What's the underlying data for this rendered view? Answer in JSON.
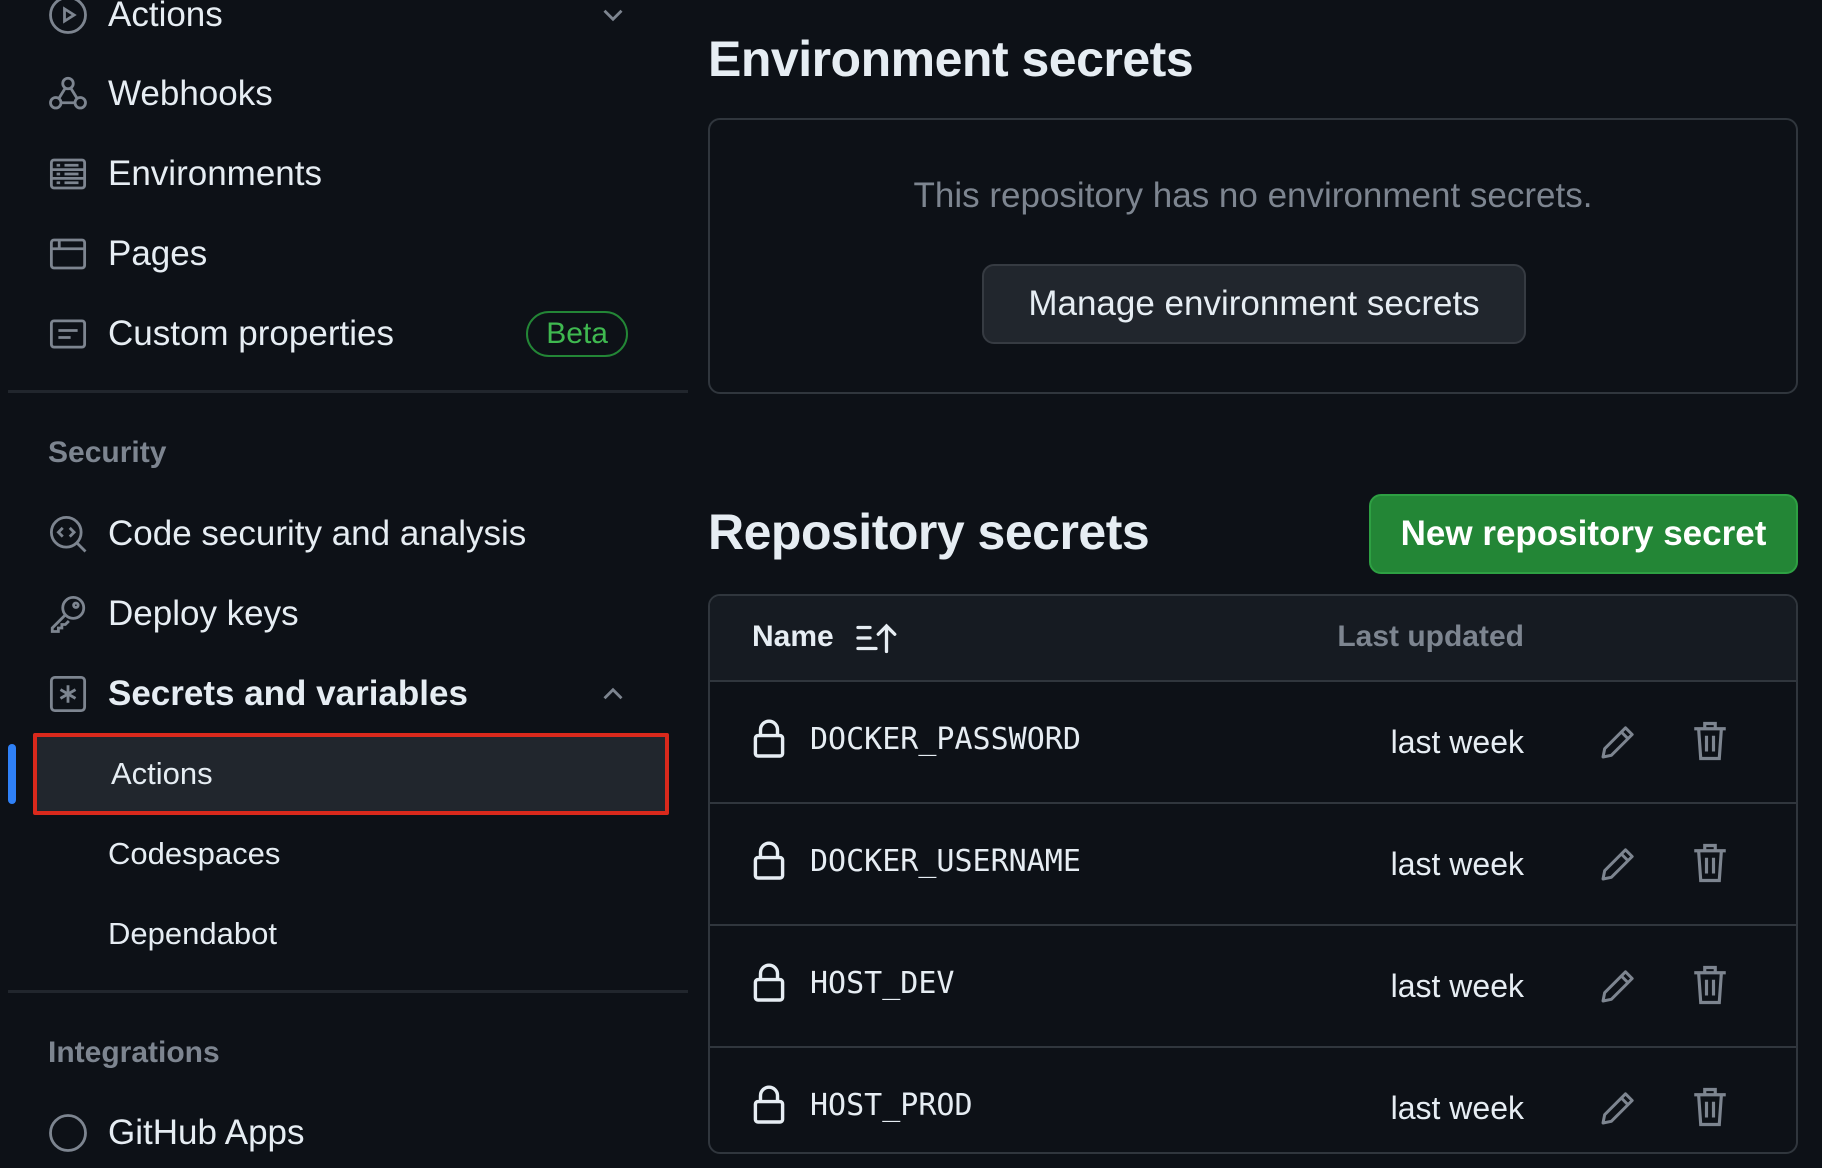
{
  "sidebar": {
    "items": [
      {
        "label": "Actions",
        "icon": "play-circle-icon"
      },
      {
        "label": "Webhooks",
        "icon": "webhook-icon"
      },
      {
        "label": "Environments",
        "icon": "server-icon"
      },
      {
        "label": "Pages",
        "icon": "browser-icon"
      },
      {
        "label": "Custom properties",
        "icon": "note-icon",
        "badge": "Beta"
      }
    ],
    "security_header": "Security",
    "security_items": [
      {
        "label": "Code security and analysis",
        "icon": "codescan-icon"
      },
      {
        "label": "Deploy keys",
        "icon": "key-icon"
      },
      {
        "label": "Secrets and variables",
        "icon": "asterisk-box-icon",
        "expanded": true
      }
    ],
    "secrets_subitems": [
      {
        "label": "Actions",
        "active": true
      },
      {
        "label": "Codespaces",
        "active": false
      },
      {
        "label": "Dependabot",
        "active": false
      }
    ],
    "integrations_header": "Integrations",
    "next_item_partial": "GitHub Apps"
  },
  "main": {
    "env_title": "Environment secrets",
    "env_empty_text": "This repository has no environment secrets.",
    "env_manage_button": "Manage environment secrets",
    "repo_title": "Repository secrets",
    "new_secret_button": "New repository secret",
    "table": {
      "col_name": "Name",
      "col_updated": "Last updated",
      "rows": [
        {
          "name": "DOCKER_PASSWORD",
          "updated": "last week"
        },
        {
          "name": "DOCKER_USERNAME",
          "updated": "last week"
        },
        {
          "name": "HOST_DEV",
          "updated": "last week"
        },
        {
          "name": "HOST_PROD",
          "updated": "last week"
        }
      ]
    }
  },
  "colors": {
    "background": "#0d1117",
    "primary_button": "#238636",
    "beta_badge": "#3fb950",
    "active_indicator": "#2f81f7",
    "highlight_border": "#d9291c"
  }
}
